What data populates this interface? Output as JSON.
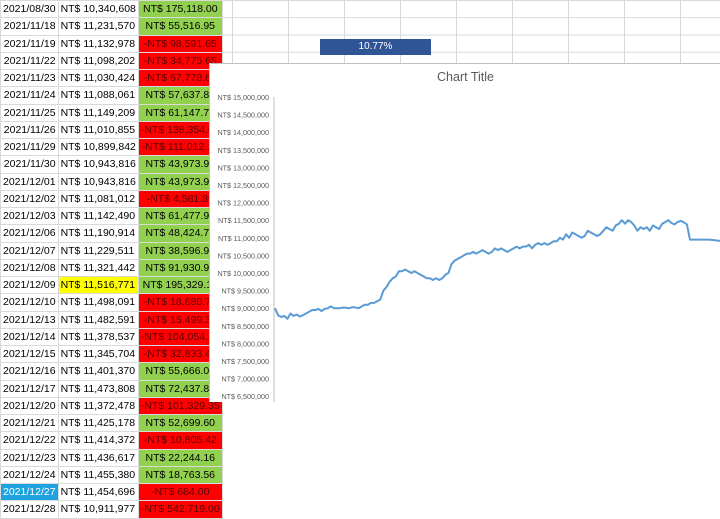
{
  "sheet": {
    "rows": [
      {
        "date": "2021/08/30",
        "value": "NT$ 10,340,608",
        "change": "NT$ 175,118.00",
        "trend": "pos"
      },
      {
        "date": "2021/11/18",
        "value": "NT$ 11,231,570",
        "change": "NT$ 55,516.95",
        "trend": "pos"
      },
      {
        "date": "2021/11/19",
        "value": "NT$ 11,132,978",
        "change": "-NT$ 98,591.65",
        "trend": "neg"
      },
      {
        "date": "2021/11/22",
        "value": "NT$ 11,098,202",
        "change": "-NT$ 34,775.65",
        "trend": "neg"
      },
      {
        "date": "2021/11/23",
        "value": "NT$ 11,030,424",
        "change": "-NT$ 67,778.62",
        "trend": "neg"
      },
      {
        "date": "2021/11/24",
        "value": "NT$ 11,088,061",
        "change": "NT$ 57,637.81",
        "trend": "pos"
      },
      {
        "date": "2021/11/25",
        "value": "NT$ 11,149,209",
        "change": "NT$ 61,147.73",
        "trend": "pos"
      },
      {
        "date": "2021/11/26",
        "value": "NT$ 11,010,855",
        "change": "-NT$ 138,354.61",
        "trend": "neg"
      },
      {
        "date": "2021/11/29",
        "value": "NT$ 10,899,842",
        "change": "-NT$ 111,012.18",
        "trend": "neg"
      },
      {
        "date": "2021/11/30",
        "value": "NT$ 10,943,816",
        "change": "NT$ 43,973.97",
        "trend": "pos"
      },
      {
        "date": "2021/12/01",
        "value": "NT$ 10,943,816",
        "change": "NT$ 43,973.97",
        "trend": "pos"
      },
      {
        "date": "2021/12/02",
        "value": "NT$ 11,081,012",
        "change": "-NT$ 4,581.89",
        "trend": "neg"
      },
      {
        "date": "2021/12/03",
        "value": "NT$ 11,142,490",
        "change": "NT$ 61,477.98",
        "trend": "pos"
      },
      {
        "date": "2021/12/06",
        "value": "NT$ 11,190,914",
        "change": "NT$ 48,424.79",
        "trend": "pos"
      },
      {
        "date": "2021/12/07",
        "value": "NT$ 11,229,511",
        "change": "NT$ 38,596.99",
        "trend": "pos"
      },
      {
        "date": "2021/12/08",
        "value": "NT$ 11,321,442",
        "change": "NT$ 91,930.90",
        "trend": "pos"
      },
      {
        "date": "2021/12/09",
        "value": "NT$ 11,516,771",
        "change": "NT$ 195,329.12",
        "trend": "pos",
        "highlight": true
      },
      {
        "date": "2021/12/10",
        "value": "NT$ 11,498,091",
        "change": "-NT$ 18,680.72",
        "trend": "neg"
      },
      {
        "date": "2021/12/13",
        "value": "NT$ 11,482,591",
        "change": "-NT$ 15,499.30",
        "trend": "neg"
      },
      {
        "date": "2021/12/14",
        "value": "NT$ 11,378,537",
        "change": "-NT$ 104,054.17",
        "trend": "neg"
      },
      {
        "date": "2021/12/15",
        "value": "NT$ 11,345,704",
        "change": "-NT$ 32,833.42",
        "trend": "neg"
      },
      {
        "date": "2021/12/16",
        "value": "NT$ 11,401,370",
        "change": "NT$ 55,666.00",
        "trend": "pos"
      },
      {
        "date": "2021/12/17",
        "value": "NT$ 11,473,808",
        "change": "NT$ 72,437.83",
        "trend": "pos"
      },
      {
        "date": "2021/12/20",
        "value": "NT$ 11,372,478",
        "change": "-NT$ 101,329.35",
        "trend": "neg"
      },
      {
        "date": "2021/12/21",
        "value": "NT$ 11,425,178",
        "change": "NT$ 52,699.60",
        "trend": "pos"
      },
      {
        "date": "2021/12/22",
        "value": "NT$ 11,414,372",
        "change": "-NT$ 10,805.42",
        "trend": "neg"
      },
      {
        "date": "2021/12/23",
        "value": "NT$ 11,436,617",
        "change": "NT$ 22,244.16",
        "trend": "pos"
      },
      {
        "date": "2021/12/24",
        "value": "NT$ 11,455,380",
        "change": "NT$ 18,763.56",
        "trend": "pos"
      },
      {
        "date": "2021/12/27",
        "value": "NT$ 11,454,696",
        "change": "-NT$ 684.00",
        "trend": "neg",
        "selected": true
      },
      {
        "date": "2021/12/28",
        "value": "NT$ 10,911,977",
        "change": "-NT$ 542,719.00",
        "trend": "neg"
      }
    ],
    "percent_cell": "10.77%"
  },
  "colors": {
    "positive": "#92d050",
    "negative": "#ff0000",
    "highlight": "#ffff00",
    "selected": "#1fa3e0",
    "percent_fill": "#2f5597",
    "line": "#5b9bd5"
  },
  "chart_data": {
    "type": "line",
    "title": "Chart Title",
    "ylim": [
      6500000,
      15000000
    ],
    "ytick_step": 500000,
    "y_tick_labels": [
      "NT$ 15,000,000",
      "NT$ 14,500,000",
      "NT$ 14,000,000",
      "NT$ 13,500,000",
      "NT$ 13,000,000",
      "NT$ 12,500,000",
      "NT$ 12,000,000",
      "NT$ 11,500,000",
      "NT$ 11,000,000",
      "NT$ 10,500,000",
      "NT$ 10,000,000",
      "NT$ 9,500,000",
      "NT$ 9,000,000",
      "NT$ 8,500,000",
      "NT$ 8,000,000",
      "NT$ 7,500,000",
      "NT$ 7,000,000",
      "NT$ 6,500,000"
    ],
    "values": [
      9000000,
      8800000,
      8750000,
      8780000,
      8700000,
      8850000,
      8780000,
      8820000,
      8760000,
      8800000,
      8850000,
      8900000,
      8950000,
      8950000,
      8980000,
      8920000,
      8980000,
      9000000,
      9050000,
      9000000,
      9000000,
      9000000,
      9020000,
      9010000,
      9000000,
      9030000,
      9020000,
      9000000,
      9050000,
      9100000,
      9100000,
      9150000,
      9150000,
      9200000,
      9250000,
      9500000,
      9600000,
      9750000,
      9850000,
      9900000,
      10050000,
      10050000,
      10100000,
      10050000,
      10000000,
      10050000,
      10000000,
      9950000,
      9900000,
      9850000,
      9850000,
      9800000,
      9850000,
      9800000,
      9850000,
      9950000,
      10000000,
      10250000,
      10350000,
      10400000,
      10450000,
      10500000,
      10550000,
      10550000,
      10600000,
      10550000,
      10600000,
      10650000,
      10600000,
      10550000,
      10600000,
      10700000,
      10650000,
      10700000,
      10650000,
      10600000,
      10650000,
      10700000,
      10750000,
      10700000,
      10750000,
      10750000,
      10800000,
      10700000,
      10800000,
      10850000,
      10800000,
      10850000,
      10800000,
      10850000,
      10900000,
      10900000,
      11000000,
      10950000,
      11100000,
      11000000,
      11150000,
      11100000,
      11050000,
      11000000,
      11050000,
      11200000,
      11150000,
      11100000,
      11050000,
      11100000,
      11200000,
      11300000,
      11250000,
      11200000,
      11350000,
      11400000,
      11500000,
      11400000,
      11500000,
      11450000,
      11350000,
      11200000,
      11300000,
      11250000,
      11300000,
      11200000,
      11350000,
      11300000,
      11250000,
      11400000,
      11450000,
      11500000,
      11420000,
      11380000,
      11450000,
      11480000,
      11440000,
      11380000,
      10950000,
      10950000,
      10950000,
      10950000,
      10950000,
      10950000,
      10950000,
      10940000,
      10930000,
      10920000,
      10910000
    ]
  }
}
